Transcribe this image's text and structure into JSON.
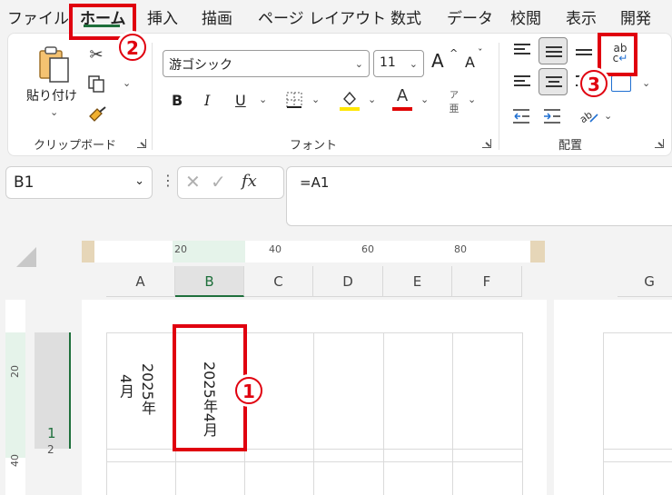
{
  "menu": {
    "tabs": [
      "ファイル",
      "ホーム",
      "挿入",
      "描画",
      "ページ レイアウト",
      "数式",
      "データ",
      "校閲",
      "表示",
      "開発"
    ],
    "active_tab": "ホーム"
  },
  "ribbon": {
    "clipboard": {
      "paste_label": "貼り付け",
      "group_label": "クリップボード"
    },
    "font": {
      "font_name": "游ゴシック",
      "font_size": "11",
      "group_label": "フォント",
      "bold": "B",
      "italic": "I",
      "underline": "U",
      "grow": "A",
      "shrink": "A",
      "font_color_letter": "A",
      "phonetic_top": "ア",
      "phonetic_bottom": "亜"
    },
    "alignment": {
      "group_label": "配置",
      "wrap_text_top": "ab",
      "wrap_text_bottom": "c"
    }
  },
  "formula_bar": {
    "cell_ref": "B1",
    "fx": "fx",
    "formula": "=A1"
  },
  "ruler": {
    "marks": [
      "20",
      "40",
      "60",
      "80"
    ]
  },
  "left_ruler": {
    "marks": [
      "20",
      "40"
    ]
  },
  "sheet": {
    "columns": [
      "A",
      "B",
      "C",
      "D",
      "E",
      "F",
      "G"
    ],
    "selected_column": "B",
    "row_number": "1",
    "row_number_2": "2",
    "cell_a1": {
      "line1": "2025年",
      "line2": "4月"
    },
    "cell_b1": "2025年4月"
  },
  "annotations": {
    "step1": "1",
    "step2": "2",
    "step3": "3"
  },
  "colors": {
    "annotation_red": "#e0000f",
    "excel_green": "#1e6f3b",
    "highlight_yellow": "#ffe600",
    "font_red": "#e00000"
  }
}
